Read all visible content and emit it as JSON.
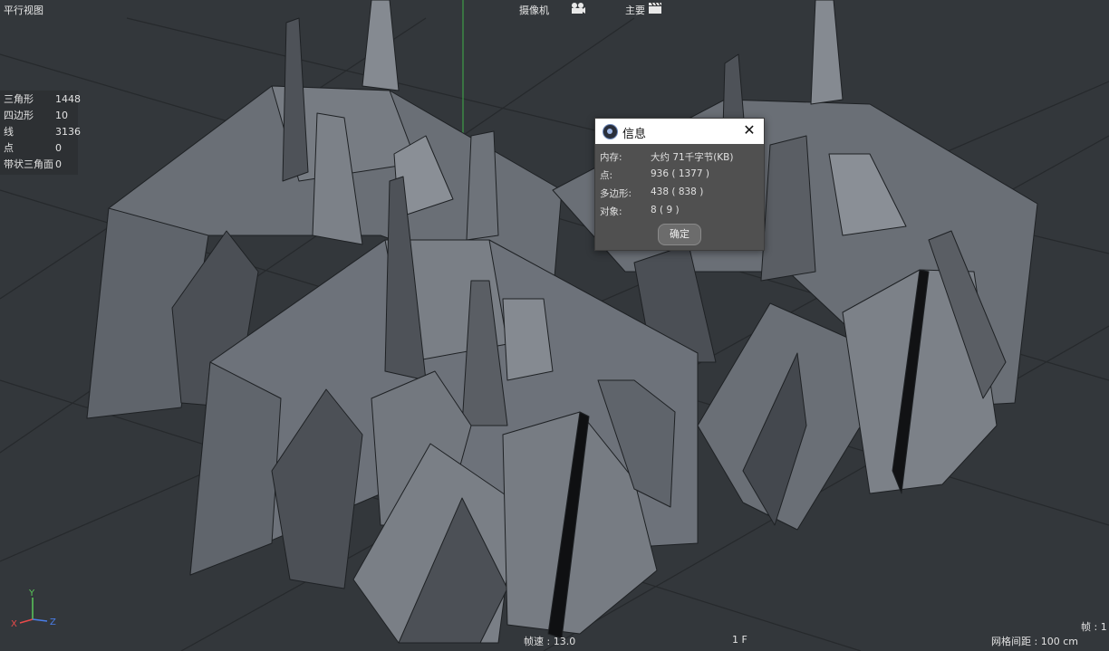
{
  "viewport": {
    "view_name": "平行视图",
    "camera_label": "摄像机",
    "display_label": "主要",
    "colors": {
      "background": "#33373b",
      "model": "#6a6f76",
      "axis_x": "#e84a4a",
      "axis_y": "#5ac85a",
      "axis_z": "#4a7ee8"
    }
  },
  "stats": [
    {
      "label": "三角形",
      "value": "1448"
    },
    {
      "label": "四边形",
      "value": "10"
    },
    {
      "label": "线",
      "value": "3136"
    },
    {
      "label": "点",
      "value": "0"
    },
    {
      "label": "带状三角面",
      "value": "0"
    }
  ],
  "axes": {
    "x": "X",
    "y": "Y",
    "z": "Z"
  },
  "footer": {
    "fps": "帧速 : 13.0",
    "frame": "1 F",
    "grid_spacing": "网格间距 : 100 cm",
    "frame_right": "帧 : 1"
  },
  "dialog": {
    "title": "信息",
    "close_icon": "close-icon",
    "rows": [
      {
        "label": "内存:",
        "value": "大约 71千字节(KB)"
      },
      {
        "label": "点:",
        "value": "936 ( 1377 )"
      },
      {
        "label": "多边形:",
        "value": "438 ( 838 )"
      },
      {
        "label": "对象:",
        "value": "8 ( 9 )"
      }
    ],
    "ok_button": "确定"
  }
}
